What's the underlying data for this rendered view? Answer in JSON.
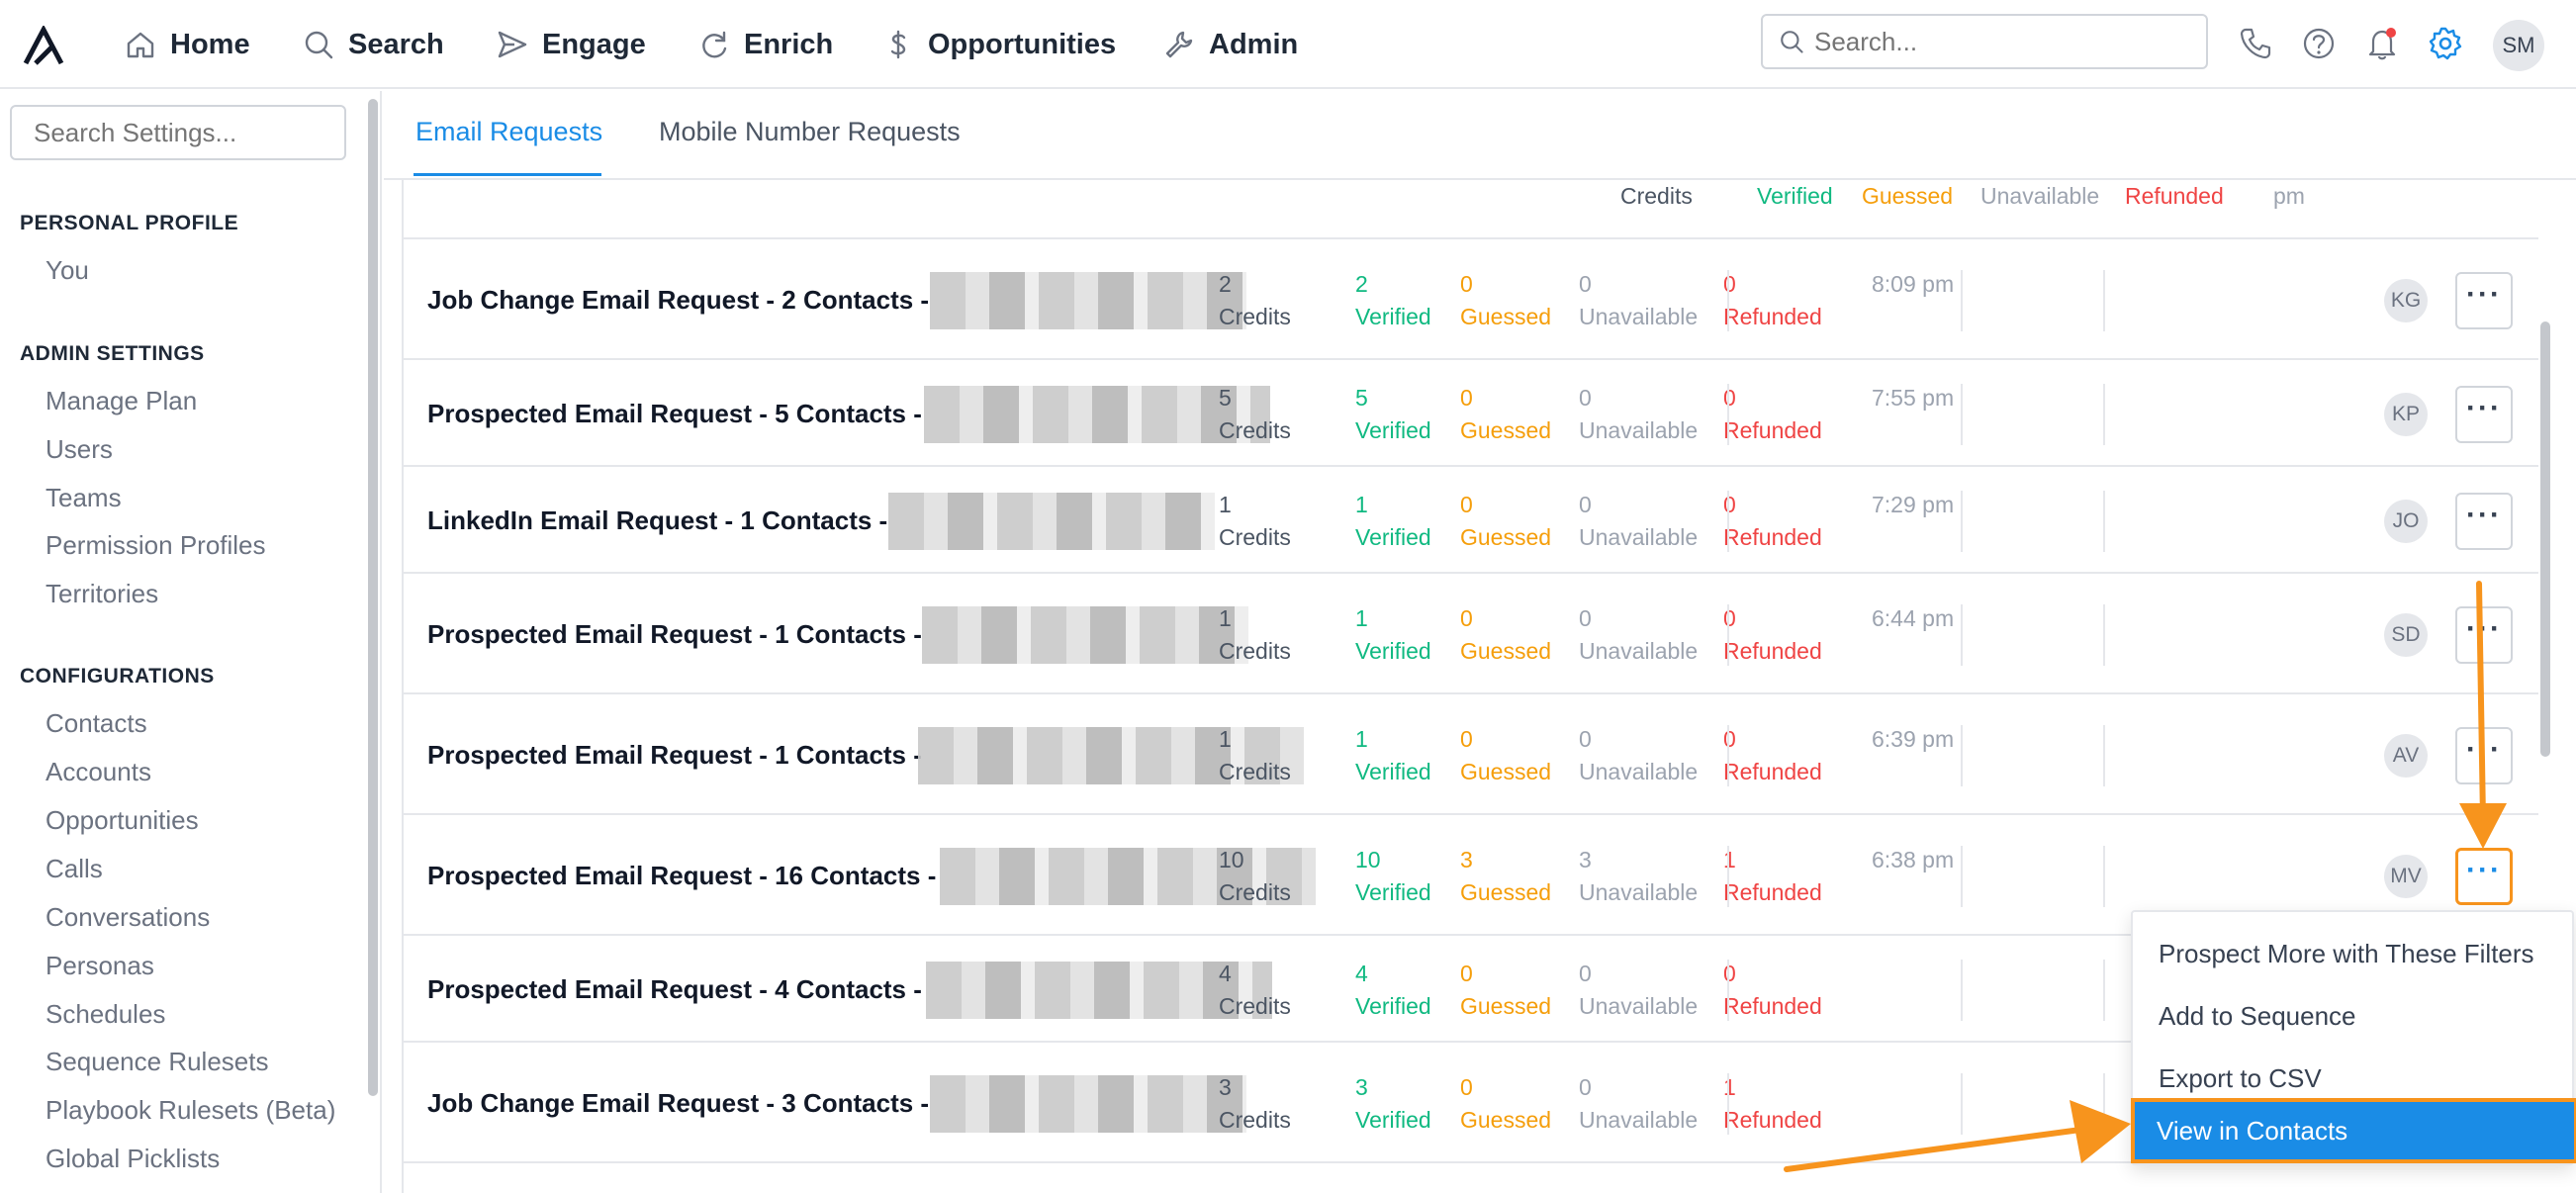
{
  "nav": {
    "items": [
      {
        "label": "Home",
        "icon": "home-icon"
      },
      {
        "label": "Search",
        "icon": "search-icon"
      },
      {
        "label": "Engage",
        "icon": "send-icon"
      },
      {
        "label": "Enrich",
        "icon": "refresh-icon"
      },
      {
        "label": "Opportunities",
        "icon": "dollar-icon"
      },
      {
        "label": "Admin",
        "icon": "wrench-icon"
      }
    ],
    "search_placeholder": "Search...",
    "user_initials": "SM"
  },
  "sidebar": {
    "search_placeholder": "Search Settings...",
    "sections": [
      {
        "heading": "PERSONAL PROFILE",
        "items": [
          "You"
        ]
      },
      {
        "heading": "ADMIN SETTINGS",
        "items": [
          "Manage Plan",
          "Users",
          "Teams",
          "Permission Profiles",
          "Territories"
        ]
      },
      {
        "heading": "CONFIGURATIONS",
        "items": [
          "Contacts",
          "Accounts",
          "Opportunities",
          "Calls",
          "Conversations",
          "Personas",
          "Schedules",
          "Sequence Rulesets",
          "Playbook Rulesets (Beta)",
          "Global Picklists"
        ]
      }
    ]
  },
  "tabs": [
    "Email Requests",
    "Mobile Number Requests"
  ],
  "partial_row": {
    "credits": "Credits",
    "verified": "Verified",
    "guessed": "Guessed",
    "unavailable": "Unavailable",
    "refunded": "Refunded",
    "time": "pm"
  },
  "rows": [
    {
      "title": "Job Change Email Request - 2 Contacts -",
      "credits": "2",
      "verified": "2",
      "guessed": "0",
      "unavailable": "0",
      "refunded": "0",
      "time": "8:09 pm",
      "initials": "KG"
    },
    {
      "title": "Prospected Email Request - 5 Contacts -",
      "credits": "5",
      "verified": "5",
      "guessed": "0",
      "unavailable": "0",
      "refunded": "0",
      "time": "7:55 pm",
      "initials": "KP"
    },
    {
      "title": "LinkedIn Email Request - 1 Contacts -",
      "credits": "1",
      "verified": "1",
      "guessed": "0",
      "unavailable": "0",
      "refunded": "0",
      "time": "7:29 pm",
      "initials": "JO"
    },
    {
      "title": "Prospected Email Request - 1 Contacts -",
      "credits": "1",
      "verified": "1",
      "guessed": "0",
      "unavailable": "0",
      "refunded": "0",
      "time": "6:44 pm",
      "initials": "SD"
    },
    {
      "title": "Prospected Email Request - 1 Contacts -",
      "credits": "1",
      "verified": "1",
      "guessed": "0",
      "unavailable": "0",
      "refunded": "0",
      "time": "6:39 pm",
      "initials": "AV"
    },
    {
      "title": "Prospected Email Request - 16 Contacts -",
      "credits": "10",
      "verified": "10",
      "guessed": "3",
      "unavailable": "3",
      "refunded": "1",
      "time": "6:38 pm",
      "initials": "MV"
    },
    {
      "title": "Prospected Email Request - 4 Contacts -",
      "credits": "4",
      "verified": "4",
      "guessed": "0",
      "unavailable": "0",
      "refunded": "0",
      "time": "",
      "initials": ""
    },
    {
      "title": "Job Change Email Request - 3 Contacts -",
      "credits": "3",
      "verified": "3",
      "guessed": "0",
      "unavailable": "0",
      "refunded": "1",
      "time": "",
      "initials": ""
    }
  ],
  "labels": {
    "credits": "Credits",
    "verified": "Verified",
    "guessed": "Guessed",
    "unavailable": "Unavailable",
    "refunded": "Refunded"
  },
  "menu": {
    "items": [
      "Prospect More with These Filters",
      "Add to Sequence",
      "Export to CSV",
      "View in Contacts"
    ],
    "highlighted_index": 3
  },
  "colors": {
    "accent": "#1a8ce6",
    "annotation": "#f7941d",
    "verified": "#10b981",
    "guessed": "#f59e0b",
    "refunded": "#ef4444"
  }
}
